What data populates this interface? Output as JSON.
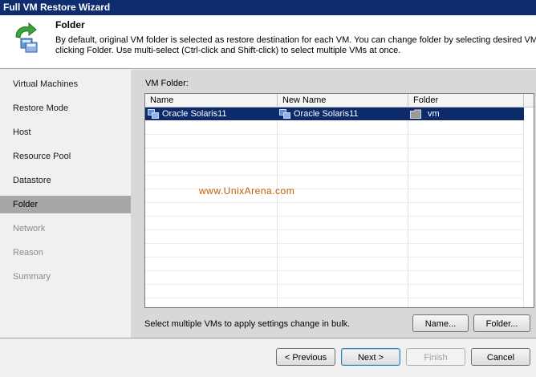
{
  "window": {
    "title": "Full VM Restore Wizard"
  },
  "header": {
    "title": "Folder",
    "desc_line1": "By default, original VM folder is selected as restore destination for each VM. You can change folder by selecting desired VM and",
    "desc_line2": "clicking Folder. Use multi-select (Ctrl-click and Shift-click) to select multiple VMs at once."
  },
  "sidebar": {
    "items": [
      {
        "label": "Virtual Machines",
        "state": "normal"
      },
      {
        "label": "Restore Mode",
        "state": "normal"
      },
      {
        "label": "Host",
        "state": "normal"
      },
      {
        "label": "Resource Pool",
        "state": "normal"
      },
      {
        "label": "Datastore",
        "state": "normal"
      },
      {
        "label": "Folder",
        "state": "active"
      },
      {
        "label": "Network",
        "state": "disabled"
      },
      {
        "label": "Reason",
        "state": "disabled"
      },
      {
        "label": "Summary",
        "state": "disabled"
      }
    ]
  },
  "main": {
    "vm_folder_label": "VM Folder:",
    "columns": [
      "Name",
      "New Name",
      "Folder"
    ],
    "rows": [
      {
        "name": "Oracle Solaris11",
        "new_name": "Oracle Solaris11",
        "folder": "vm",
        "selected": true
      }
    ],
    "watermark": "www.UnixArena.com",
    "bulk_hint": "Select multiple VMs to apply settings change in bulk.",
    "name_button": "Name...",
    "folder_button": "Folder..."
  },
  "footer": {
    "previous": "< Previous",
    "next": "Next >",
    "finish": "Finish",
    "cancel": "Cancel"
  },
  "colors": {
    "titlebar": "#0d2d6e",
    "selection": "#0d2a6a",
    "active_nav": "#a7a7a7",
    "watermark": "#c35a00"
  }
}
